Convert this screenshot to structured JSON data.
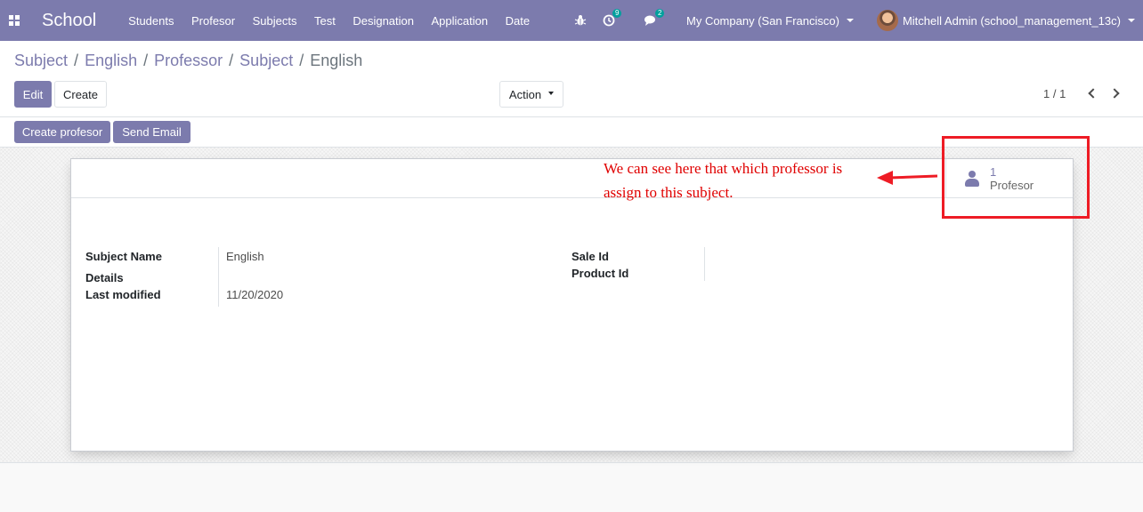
{
  "navbar": {
    "app_name": "School",
    "menu": [
      "Students",
      "Profesor",
      "Subjects",
      "Test",
      "Designation",
      "Application",
      "Date"
    ],
    "activity_count": "9",
    "message_count": "2",
    "company": "My Company (San Francisco)",
    "user": "Mitchell Admin (school_management_13c)"
  },
  "breadcrumb": [
    {
      "label": "Subject"
    },
    {
      "label": "English"
    },
    {
      "label": "Professor"
    },
    {
      "label": "Subject"
    }
  ],
  "breadcrumb_active": "English",
  "buttons": {
    "edit": "Edit",
    "create": "Create",
    "action": "Action",
    "create_profesor": "Create profesor",
    "send_email": "Send Email"
  },
  "pager": {
    "value": "1 / 1"
  },
  "stat_button": {
    "value": "1",
    "label": "Profesor"
  },
  "form": {
    "subject_name_label": "Subject Name",
    "subject_name_value": "English",
    "details_label": "Details",
    "last_modified_label": "Last modified",
    "last_modified_value": "11/20/2020",
    "sale_id_label": "Sale Id",
    "product_id_label": "Product Id"
  },
  "annotation": {
    "text": "We can see here that which professor is assign to this subject."
  },
  "colors": {
    "brand": "#7c7bad",
    "annotation": "#e00000",
    "highlight": "#ee1c25"
  }
}
